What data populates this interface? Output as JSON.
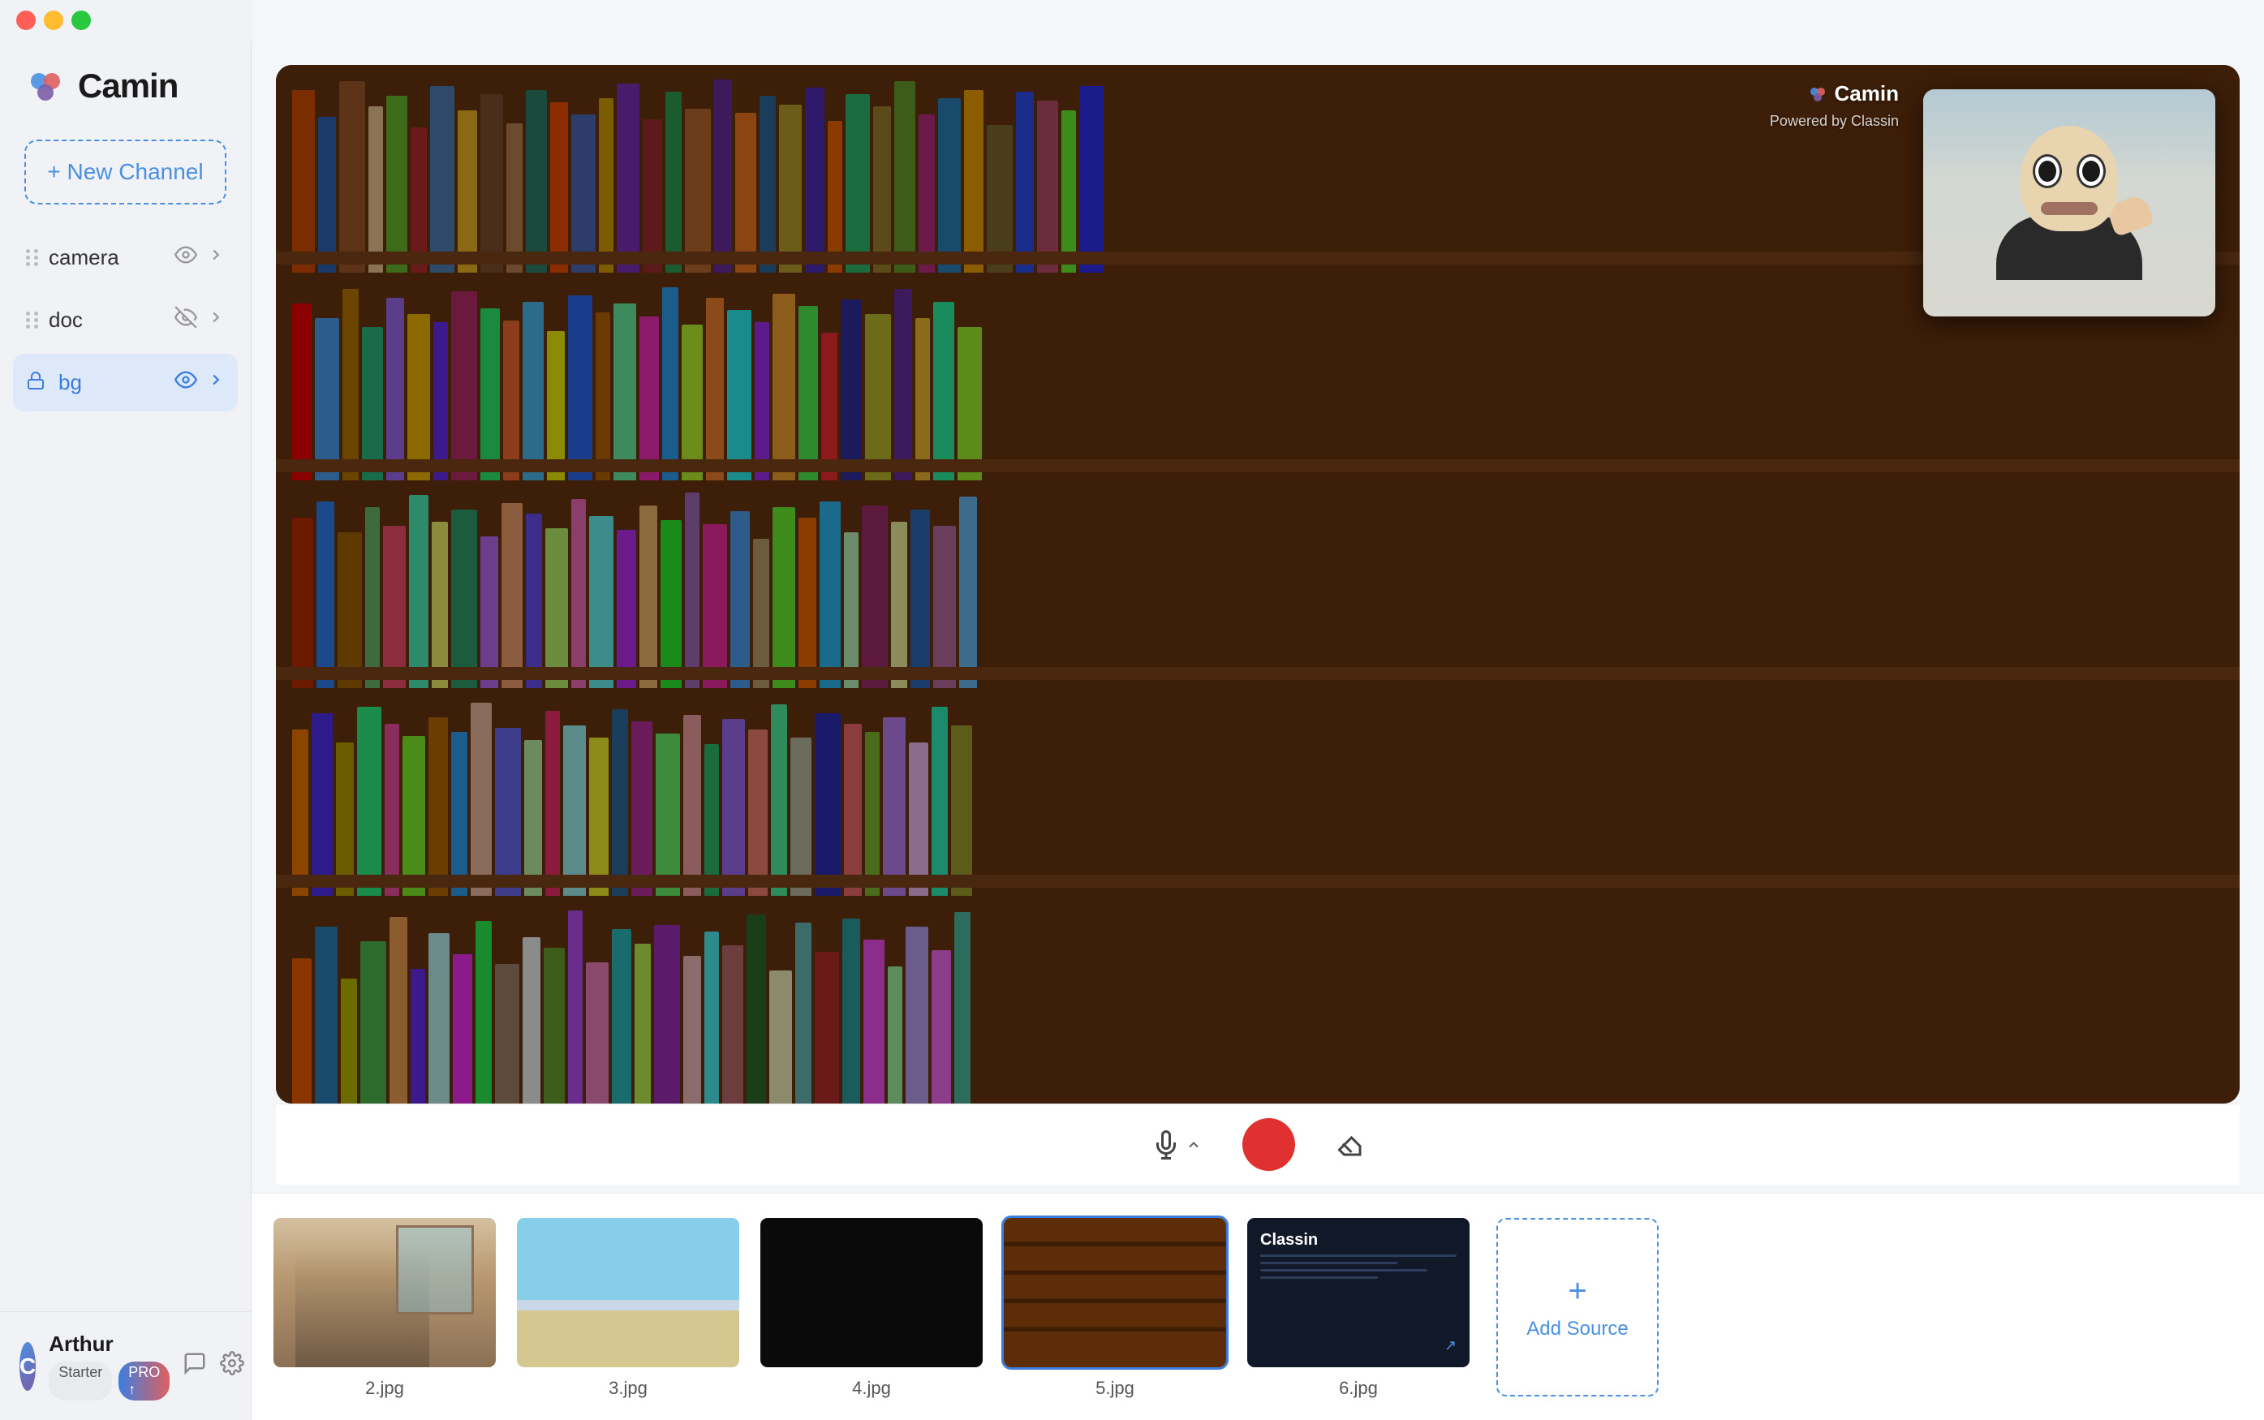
{
  "app": {
    "name": "Camin",
    "subtitle": "Powered by Classin"
  },
  "titlebar": {
    "traffic_lights": [
      "close",
      "minimize",
      "maximize"
    ]
  },
  "sidebar": {
    "new_channel_label": "+ New Channel",
    "channels": [
      {
        "id": "camera",
        "name": "camera",
        "visible": true,
        "locked": false,
        "active": false
      },
      {
        "id": "doc",
        "name": "doc",
        "visible": false,
        "locked": false,
        "active": false
      },
      {
        "id": "bg",
        "name": "bg",
        "visible": true,
        "locked": true,
        "active": true
      }
    ]
  },
  "user": {
    "name": "Arthur",
    "avatar_letter": "C",
    "badges": [
      {
        "label": "Starter",
        "type": "starter"
      },
      {
        "label": "PRO ↑",
        "type": "pro"
      }
    ]
  },
  "preview": {
    "watermark_brand": "Camin",
    "watermark_sub": "Powered by Classin"
  },
  "controls": {
    "mic_label": "mic",
    "record_label": "record",
    "erase_label": "erase"
  },
  "thumbnails": [
    {
      "id": "2",
      "label": "2.jpg",
      "type": "room",
      "active": false
    },
    {
      "id": "3",
      "label": "3.jpg",
      "type": "beach",
      "active": false
    },
    {
      "id": "4",
      "label": "4.jpg",
      "type": "dark",
      "active": false
    },
    {
      "id": "5",
      "label": "5.jpg",
      "type": "books",
      "active": true
    },
    {
      "id": "6",
      "label": "6.jpg",
      "type": "classin",
      "active": false
    }
  ],
  "add_source": {
    "label": "Add Source",
    "plus": "+"
  }
}
